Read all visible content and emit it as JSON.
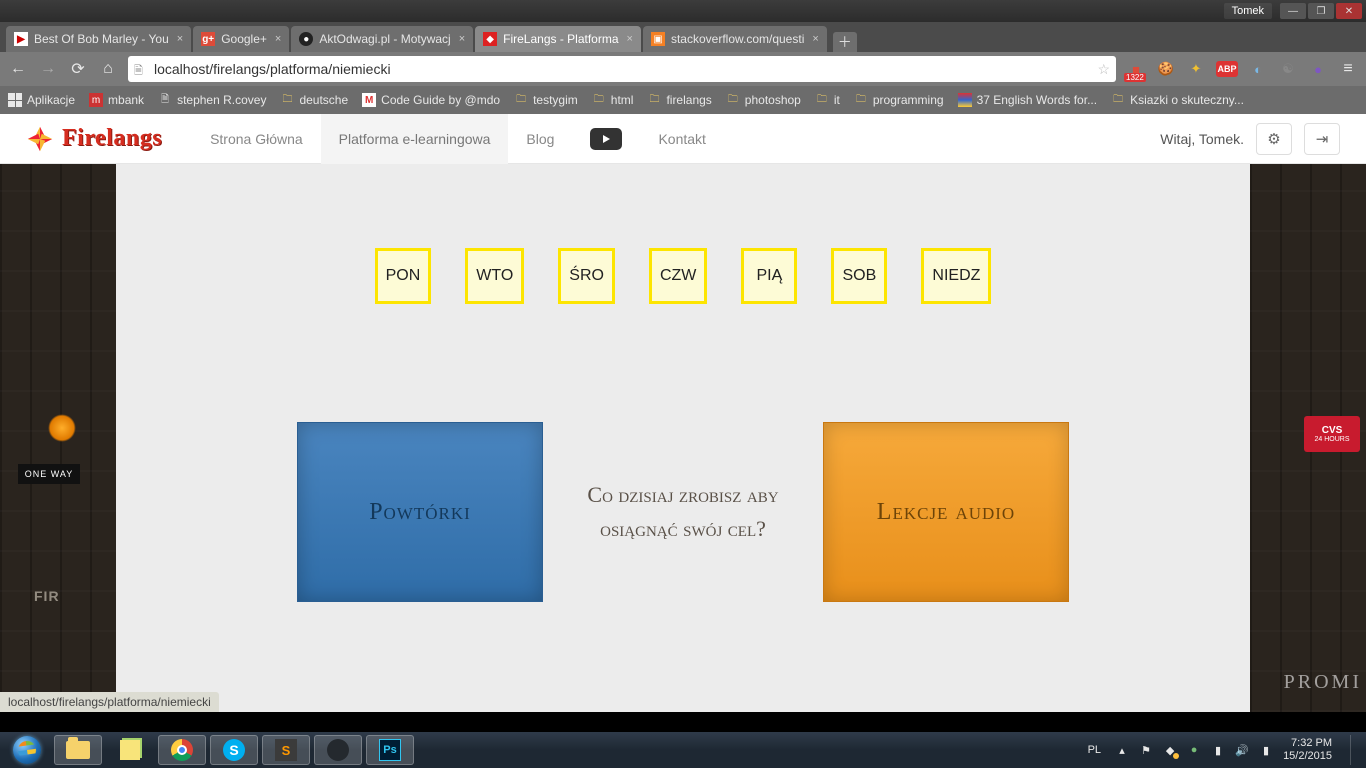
{
  "win": {
    "user": "Tomek"
  },
  "tabs": [
    {
      "title": "Best Of Bob Marley - You",
      "fav": "yt",
      "favtxt": "▶"
    },
    {
      "title": "Google+",
      "fav": "gp",
      "favtxt": "g+"
    },
    {
      "title": "AktOdwagi.pl - Motywacj",
      "fav": "akt",
      "favtxt": "●"
    },
    {
      "title": "FireLangs - Platforma",
      "fav": "fl",
      "favtxt": "◆",
      "active": true
    },
    {
      "title": "stackoverflow.com/questi",
      "fav": "so",
      "favtxt": "▣"
    }
  ],
  "addr": {
    "url": "localhost/firelangs/platforma/niemiecki",
    "gplus_badge": "1322"
  },
  "bookmarks": {
    "apps": "Aplikacje",
    "items": [
      {
        "label": "mbank",
        "ic": "mb",
        "txt": "m"
      },
      {
        "label": "stephen R.covey",
        "ic": "page",
        "txt": "🗎"
      },
      {
        "label": "deutsche",
        "ic": "folder",
        "txt": "🗀"
      },
      {
        "label": "Code Guide by @mdo",
        "ic": "gm",
        "txt": "M"
      },
      {
        "label": "testygim",
        "ic": "folder",
        "txt": "🗀"
      },
      {
        "label": "html",
        "ic": "folder",
        "txt": "🗀"
      },
      {
        "label": "firelangs",
        "ic": "folder",
        "txt": "🗀"
      },
      {
        "label": "photoshop",
        "ic": "folder",
        "txt": "🗀"
      },
      {
        "label": "it",
        "ic": "folder",
        "txt": "🗀"
      },
      {
        "label": "programming",
        "ic": "folder",
        "txt": "🗀"
      },
      {
        "label": "37 English Words for...",
        "ic": "page",
        "txt": "🗎"
      },
      {
        "label": "Ksiazki o skuteczny...",
        "ic": "folder",
        "txt": "🗀"
      }
    ]
  },
  "site": {
    "brand": "Firelangs",
    "nav": {
      "home": "Strona Główna",
      "platform": "Platforma e-learningowa",
      "blog": "Blog",
      "contact": "Kontakt"
    },
    "greeting": "Witaj, Tomek."
  },
  "days": [
    "PON",
    "WTO",
    "ŚRO",
    "CZW",
    "PIĄ",
    "SOB",
    "NIEDZ"
  ],
  "cards": {
    "left": "Powtórki",
    "right": "Lekcje audio",
    "question": "Co dzisiaj zrobisz aby osiągnąć swój cel?"
  },
  "bg": {
    "oneway": "ONE WAY",
    "cvs1": "CVS",
    "cvs2": "24 HOURS",
    "promi": "PROMI",
    "fir": "FIR"
  },
  "status": "localhost/firelangs/platforma/niemiecki",
  "tray": {
    "lang": "PL",
    "time": "7:32 PM",
    "date": "15/2/2015"
  }
}
